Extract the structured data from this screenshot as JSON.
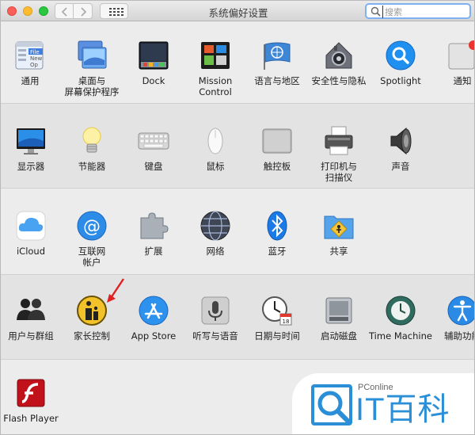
{
  "window": {
    "title": "系统偏好设置",
    "search_placeholder": "搜索"
  },
  "sections": [
    {
      "items": [
        {
          "label": "通用",
          "icon": "general-icon"
        },
        {
          "label": "桌面与\n屏幕保护程序",
          "icon": "desktop-screensaver-icon"
        },
        {
          "label": "Dock",
          "icon": "dock-icon"
        },
        {
          "label": "Mission\nControl",
          "icon": "mission-control-icon"
        },
        {
          "label": "语言与地区",
          "icon": "language-region-icon"
        },
        {
          "label": "安全性与隐私",
          "icon": "security-privacy-icon"
        },
        {
          "label": "Spotlight",
          "icon": "spotlight-icon"
        },
        {
          "label": "通知",
          "icon": "notifications-icon"
        }
      ]
    },
    {
      "items": [
        {
          "label": "显示器",
          "icon": "displays-icon"
        },
        {
          "label": "节能器",
          "icon": "energy-saver-icon"
        },
        {
          "label": "键盘",
          "icon": "keyboard-icon"
        },
        {
          "label": "鼠标",
          "icon": "mouse-icon"
        },
        {
          "label": "触控板",
          "icon": "trackpad-icon"
        },
        {
          "label": "打印机与\n扫描仪",
          "icon": "printers-scanners-icon"
        },
        {
          "label": "声音",
          "icon": "sound-icon"
        }
      ]
    },
    {
      "items": [
        {
          "label": "iCloud",
          "icon": "icloud-icon"
        },
        {
          "label": "互联网\n帐户",
          "icon": "internet-accounts-icon"
        },
        {
          "label": "扩展",
          "icon": "extensions-icon"
        },
        {
          "label": "网络",
          "icon": "network-icon"
        },
        {
          "label": "蓝牙",
          "icon": "bluetooth-icon"
        },
        {
          "label": "共享",
          "icon": "sharing-icon"
        }
      ]
    },
    {
      "items": [
        {
          "label": "用户与群组",
          "icon": "users-groups-icon"
        },
        {
          "label": "家长控制",
          "icon": "parental-controls-icon"
        },
        {
          "label": "App Store",
          "icon": "app-store-icon"
        },
        {
          "label": "听写与语音",
          "icon": "dictation-speech-icon"
        },
        {
          "label": "日期与时间",
          "icon": "date-time-icon"
        },
        {
          "label": "启动磁盘",
          "icon": "startup-disk-icon"
        },
        {
          "label": "Time Machine",
          "icon": "time-machine-icon"
        },
        {
          "label": "辅助功能",
          "icon": "accessibility-icon"
        }
      ]
    },
    {
      "items": [
        {
          "label": "Flash Player",
          "icon": "flash-player-icon"
        }
      ]
    }
  ],
  "watermark": {
    "brand_small": "PConline",
    "brand_big": "IT百科"
  },
  "colors": {
    "accent": "#2a8fd6",
    "annotation_arrow": "#e02020"
  }
}
